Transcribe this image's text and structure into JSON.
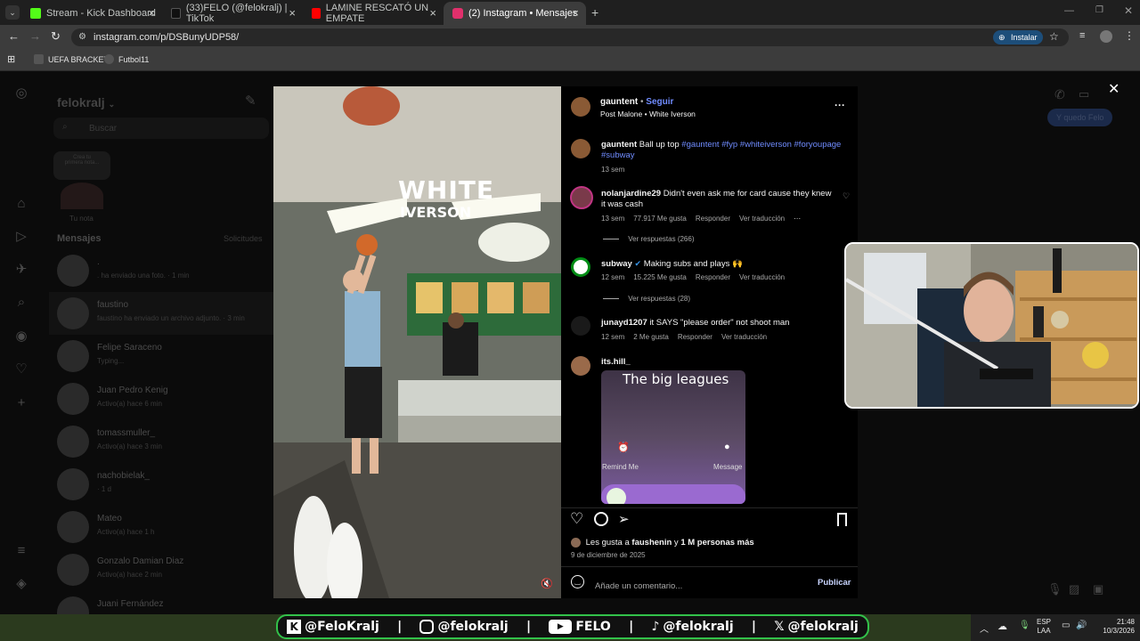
{
  "browser": {
    "tabs": [
      {
        "title": "Stream - Kick Dashboard",
        "color": "#53fc18"
      },
      {
        "title": "(33)FELO (@felokralj) | TikTok",
        "color": "#111111"
      },
      {
        "title": "LAMINE RESCATÓ UN EMPATE",
        "color": "#ff0000"
      },
      {
        "title": "(2) Instagram • Mensajes",
        "color": "#e1306c"
      }
    ],
    "url": "instagram.com/p/DSBunyUDP58/",
    "install_label": "Instalar",
    "bookmarks": [
      "UEFA BRACKET",
      "Futbol11"
    ]
  },
  "ig": {
    "account": "felokralj",
    "search_placeholder": "Buscar",
    "note_hint": "Crea tu primera nota...",
    "your_note": "Tu nota",
    "messages_label": "Mensajes",
    "requests_label": "Solicitudes",
    "conversations": [
      {
        "name": ".",
        "sub": ". ha enviado una foto. · 1 min"
      },
      {
        "name": "faustino",
        "sub": "faustino ha enviado un archivo adjunto. · 3 min"
      },
      {
        "name": "Felipe Saraceno",
        "sub": "Typing..."
      },
      {
        "name": "Juan Pedro Kenig",
        "sub": "Activo(a) hace 6 min"
      },
      {
        "name": "tomassmuller_",
        "sub": "Activo(a) hace 3 min"
      },
      {
        "name": "nachobielak_",
        "sub": "· 1 d"
      },
      {
        "name": "Mateo",
        "sub": "Activo(a) hace 1 h"
      },
      {
        "name": "Gonzalo Damian Diaz",
        "sub": "Activo(a) hace 2 min"
      },
      {
        "name": "Juani Fernández",
        "sub": ""
      }
    ],
    "chat_bubble": "Y quedo Felo"
  },
  "post": {
    "overlay_line1": "WHITE",
    "overlay_line2": "IVERSON",
    "author": "gauntent",
    "follow": "Seguir",
    "audio": "Post Malone • White Iverson",
    "caption_text": "Ball up top",
    "hashtags": "#gauntent #fyp #whiteiverson #foryoupage #subway",
    "caption_time": "13 sem",
    "comments": [
      {
        "user": "nolanjardine29",
        "text": "Didn't even ask me for card cause they knew it was cash",
        "time": "13 sem",
        "likes": "77.917 Me gusta",
        "reply": "Responder",
        "translate": "Ver traducción",
        "more": "Ver respuestas (266)"
      },
      {
        "user": "subway",
        "text": "Making subs and plays 🙌",
        "time": "12 sem",
        "likes": "15.225 Me gusta",
        "reply": "Responder",
        "translate": "Ver traducción",
        "more": "Ver respuestas (28)"
      },
      {
        "user": "junayd1207",
        "text": "it SAYS \"please order\" not shoot man",
        "time": "12 sem",
        "likes": "2 Me gusta",
        "reply": "Responder",
        "translate": "Ver traducción"
      },
      {
        "user": "its.hill_",
        "image_title": "The big leagues",
        "image_btn1": "Remind Me",
        "image_btn2": "Message"
      }
    ],
    "likes_prefix": "Les gusta a",
    "likes_user": "faushenin",
    "likes_connector": "y",
    "likes_rest": "1 M personas más",
    "date": "9 de diciembre de 2025",
    "comment_placeholder": "Añade un comentario...",
    "publish": "Publicar"
  },
  "banner": {
    "kick": "@FeloKralj",
    "instagram": "@felokralj",
    "youtube": "FELO",
    "tiktok": "@felokralj",
    "x": "@felokralj"
  },
  "taskbar": {
    "lang1": "ESP",
    "lang2": "LAA",
    "time": "21:48",
    "date": "10/3/2026"
  }
}
